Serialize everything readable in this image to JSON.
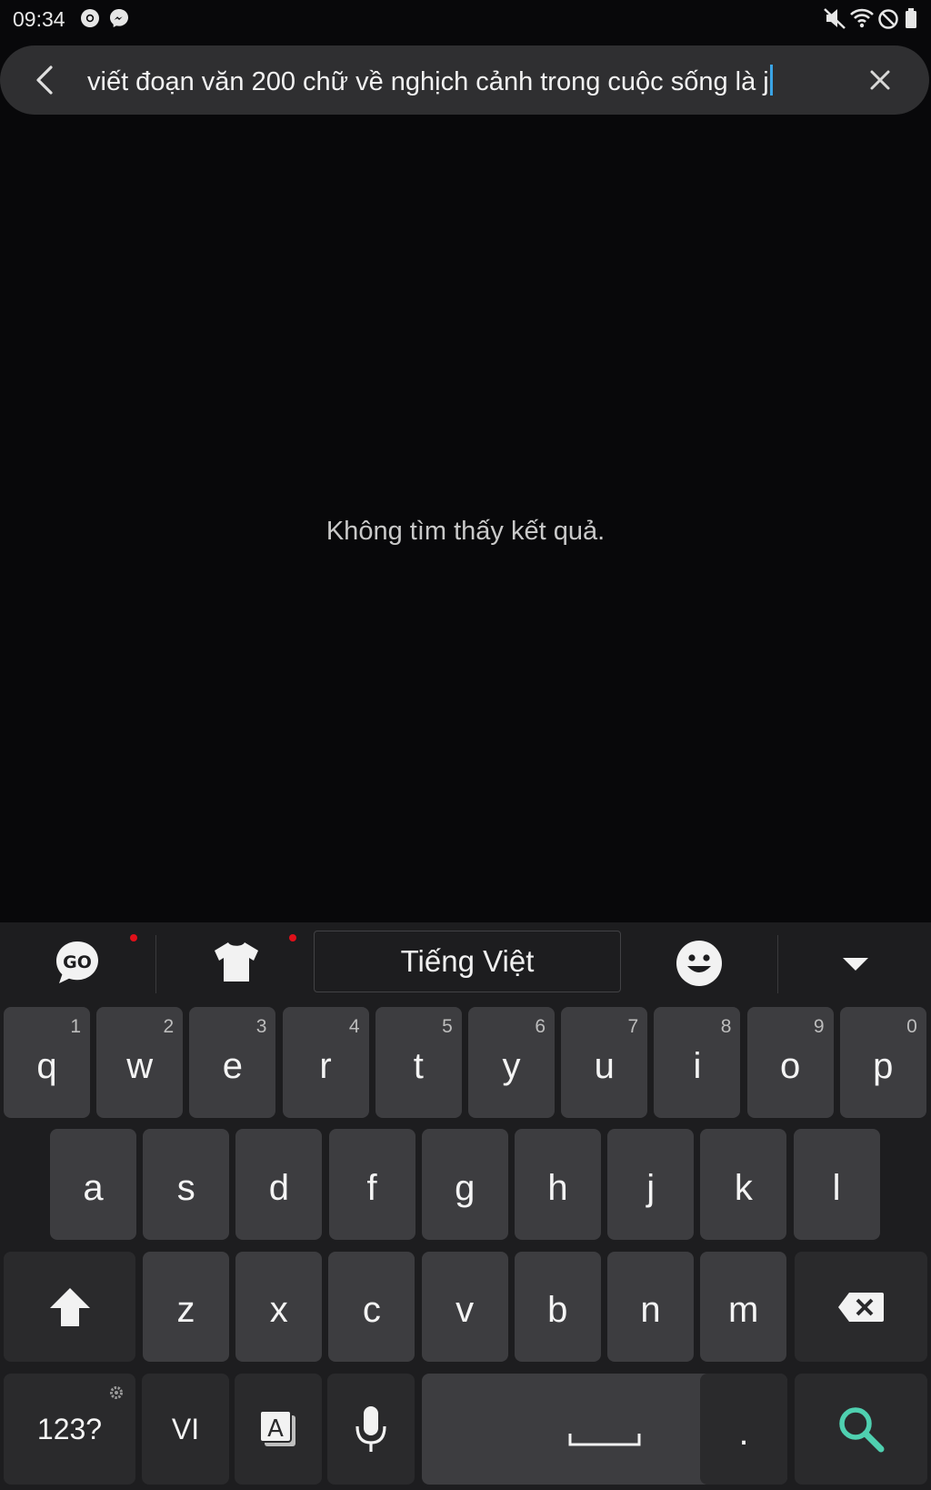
{
  "status": {
    "time": "09:34",
    "icons": [
      "chrome-icon",
      "messenger-icon",
      "mute-icon",
      "wifi-icon",
      "dnd-icon",
      "battery-icon"
    ]
  },
  "search": {
    "query": "viết đoạn văn 200 chữ về nghịch cảnh trong cuộc sống là j",
    "back_icon": "back-arrow-icon",
    "clear_icon": "close-icon"
  },
  "results": {
    "empty_message": "Không tìm thấy kết quả."
  },
  "keyboard": {
    "language": "Tiếng Việt",
    "toolbar_icons": [
      "go-logo-icon",
      "theme-shirt-icon",
      "emoji-icon",
      "collapse-icon"
    ],
    "row1": [
      {
        "k": "q",
        "n": "1"
      },
      {
        "k": "w",
        "n": "2"
      },
      {
        "k": "e",
        "n": "3"
      },
      {
        "k": "r",
        "n": "4"
      },
      {
        "k": "t",
        "n": "5"
      },
      {
        "k": "y",
        "n": "6"
      },
      {
        "k": "u",
        "n": "7"
      },
      {
        "k": "i",
        "n": "8"
      },
      {
        "k": "o",
        "n": "9"
      },
      {
        "k": "p",
        "n": "0"
      }
    ],
    "row2": [
      "a",
      "s",
      "d",
      "f",
      "g",
      "h",
      "j",
      "k",
      "l"
    ],
    "row3": [
      "z",
      "x",
      "c",
      "v",
      "b",
      "n",
      "m"
    ],
    "numbers_key": "123?",
    "lang_key": "VI",
    "period_key": ".",
    "accent_color": "#4fd0b0"
  }
}
